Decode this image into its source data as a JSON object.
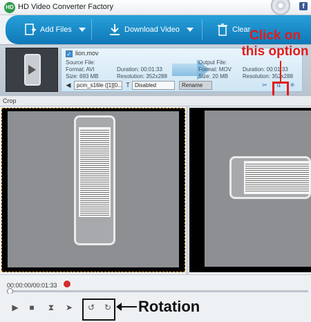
{
  "window": {
    "title": "HD Video Converter Factory",
    "logo_text": "HD",
    "facebook_icon": "facebook-icon"
  },
  "toolbar": {
    "add_files_label": "Add Files",
    "download_video_label": "Download Video",
    "clear_label": "Clear"
  },
  "file": {
    "name": "lion.mov",
    "source_heading": "Source File:",
    "source_format": "Format: AVI",
    "source_size": "Size: 693 MB",
    "source_duration": "Duration: 00:01:33",
    "source_resolution": "Resolution: 352x288",
    "output_heading": "Output File:",
    "output_format": "Format: MOV",
    "output_size": "Size: 20 MB",
    "output_duration": "Duration: 00:01:33",
    "output_resolution": "Resolution: 352x288",
    "audio_select": "pcm_s16le ([1][0...",
    "subtitle_select": "Disabled",
    "rename_label": "Rename"
  },
  "annotation": {
    "click_text": "Click on this option",
    "rotation_label": "Rotation",
    "color": "#e21b1b"
  },
  "crop": {
    "label": "Crop"
  },
  "timeline": {
    "time_display": "00:00:00/00:01:33",
    "progress": 0
  },
  "controls": {
    "play_icon": "play-icon",
    "stop_icon": "stop-icon",
    "flip_horizontal_icon": "flip-horizontal-icon",
    "flip_vertical_icon": "flip-vertical-icon",
    "rotate_left_icon": "rotate-left-icon",
    "rotate_right_icon": "rotate-right-icon"
  }
}
